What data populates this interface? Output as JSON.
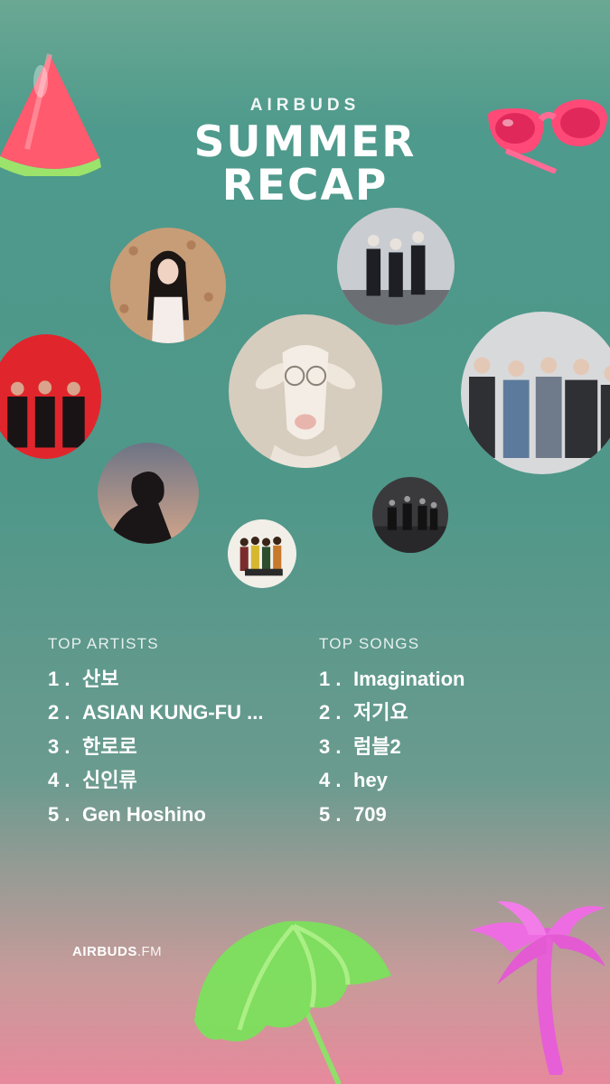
{
  "brand": "AIRBUDS",
  "title_line1": "SUMMER",
  "title_line2": "RECAP",
  "top_artists": {
    "heading": "TOP ARTISTS",
    "items": [
      {
        "rank": "1 .",
        "name": "산보"
      },
      {
        "rank": "2 .",
        "name": "ASIAN KUNG-FU ..."
      },
      {
        "rank": "3 .",
        "name": "한로로"
      },
      {
        "rank": "4 .",
        "name": "신인류"
      },
      {
        "rank": "5 .",
        "name": "Gen Hoshino"
      }
    ]
  },
  "top_songs": {
    "heading": "TOP SONGS",
    "items": [
      {
        "rank": "1 .",
        "name": "Imagination"
      },
      {
        "rank": "2 .",
        "name": "저기요"
      },
      {
        "rank": "3 .",
        "name": "럼블2"
      },
      {
        "rank": "4 .",
        "name": "hey"
      },
      {
        "rank": "5 .",
        "name": "709"
      }
    ]
  },
  "footer": {
    "brand": "AIRBUDS",
    "suffix": ".FM"
  },
  "decorations": [
    "watermelon-icon",
    "sunglasses-icon",
    "umbrella-icon",
    "palm-tree-icon"
  ],
  "colors": {
    "background_top": "#6aa893",
    "background_bottom": "#e7899c",
    "text": "#ffffff"
  }
}
